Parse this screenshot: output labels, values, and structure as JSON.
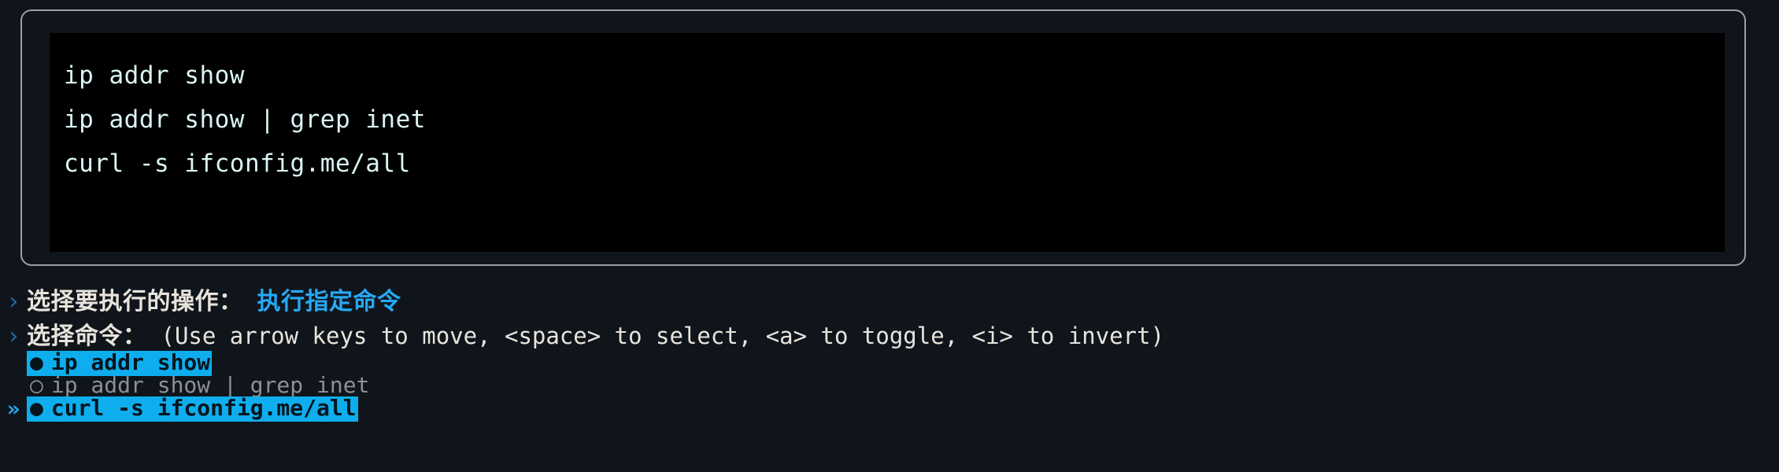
{
  "terminal": {
    "lines": [
      "ip addr show",
      "ip addr show | grep inet",
      "curl -s ifconfig.me/all"
    ]
  },
  "prompt": {
    "chevron_icon": "›",
    "cursor_icon": "»",
    "radio_selected_icon": "●",
    "radio_unselected_icon": "○",
    "accent_color": "#0eaeee",
    "answer_color": "#26a9f4",
    "chevron_color": "#1b6ea8",
    "questions": [
      {
        "label": "选择要执行的操作：",
        "answer": "执行指定命令"
      },
      {
        "label": "选择命令：",
        "hint": "(Use arrow keys to move, <space> to select, <a> to toggle, <i> to invert)"
      }
    ],
    "choices": [
      {
        "label": "ip addr show",
        "selected": true,
        "cursor": false
      },
      {
        "label": "ip addr show | grep inet",
        "selected": false,
        "cursor": false
      },
      {
        "label": "curl -s ifconfig.me/all",
        "selected": true,
        "cursor": true
      }
    ]
  }
}
